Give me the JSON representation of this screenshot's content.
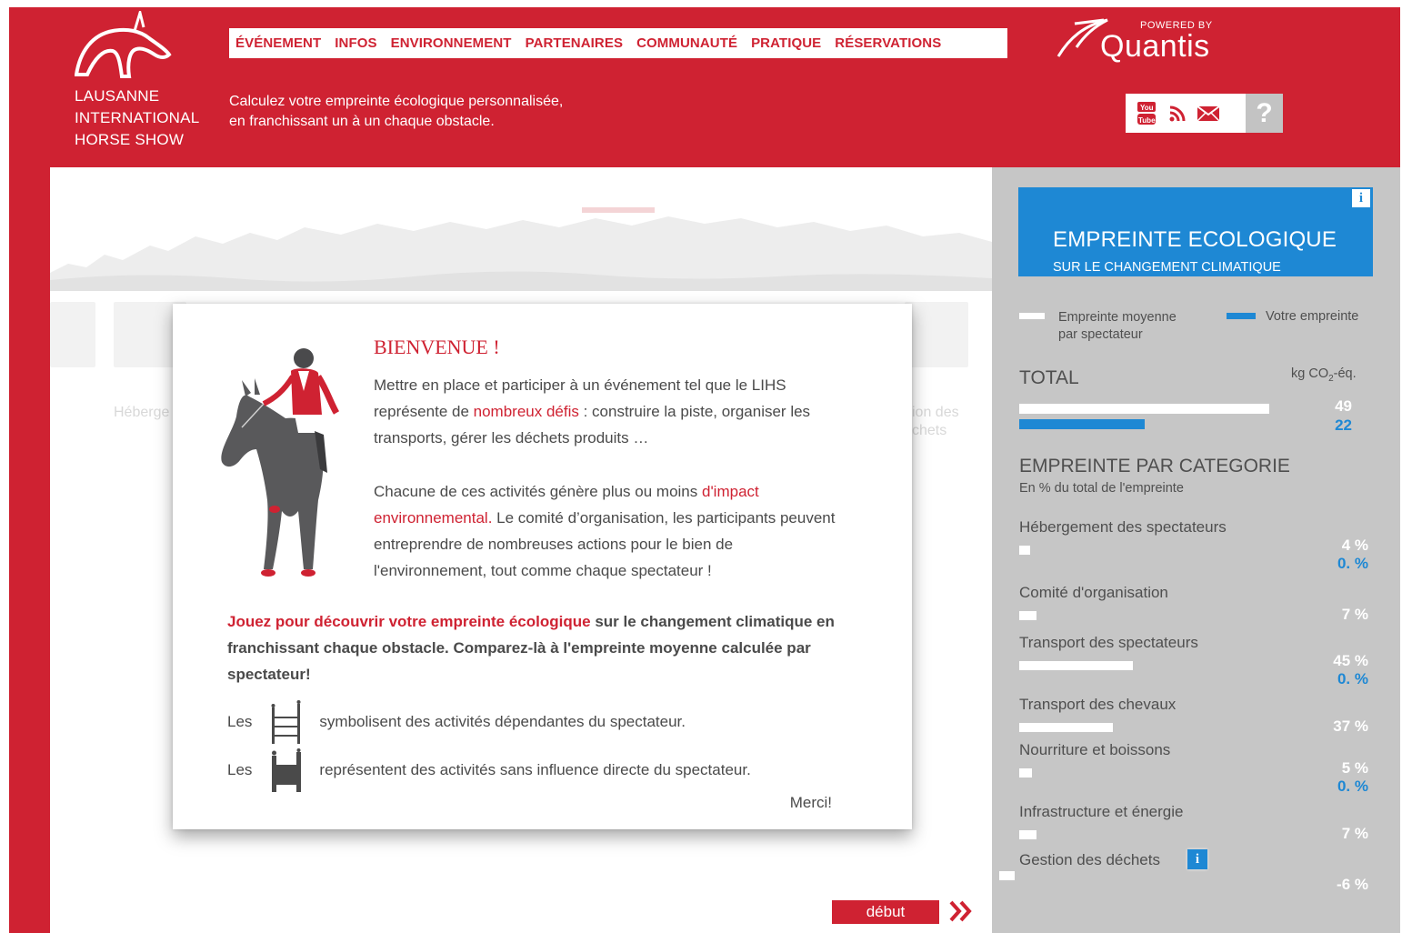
{
  "header": {
    "brand_lines": [
      "LAUSANNE",
      "INTERNATIONAL",
      "HORSE SHOW"
    ],
    "nav": [
      "ÉVÉNEMENT",
      "INFOS",
      "ENVIRONNEMENT",
      "PARTENAIRES",
      "COMMUNAUTÉ",
      "PRATIQUE",
      "RÉSERVATIONS"
    ],
    "tagline": [
      "Calculez votre empreinte écologique personnalisée,",
      "en franchissant un à un chaque obstacle."
    ],
    "powered_by": "POWERED BY",
    "partner": "Quantis",
    "social_icons": [
      "youtube-icon",
      "rss-icon",
      "mail-icon"
    ],
    "help_label": "?",
    "colors": {
      "brand_red": "#cf2232",
      "accent_blue": "#1e88d4",
      "sidebar_grey": "#c6c6c6"
    }
  },
  "main": {
    "bg_labels": [
      "Héberge",
      "ion des",
      "chets"
    ],
    "start_label": "début",
    "start_arrows": "»"
  },
  "modal": {
    "title": "BIENVENUE !",
    "p1_a": "Mettre en place et participer à un événement tel que le LIHS représente de ",
    "p1_b": "nombreux défis",
    "p1_c": " : construire la piste, organiser les transports, gérer les déchets produits …",
    "p2_a": "Chacune de ces activités génère plus ou moins ",
    "p2_b": "d'impact environnemental.",
    "p2_c": " Le comité d’organisation, les participants peuvent entreprendre de nombreuses actions pour le bien de l'environnement, tout comme chaque spectateur !",
    "bold_a": "Jouez pour découvrir votre empreinte écologique",
    "bold_b": " sur le changement climatique en franchissant chaque obstacle. Comparez-là à l'empreinte moyenne calculée par spectateur!",
    "legend1_pre": "Les",
    "legend1_post": "symbolisent des activités dépendantes du spectateur.",
    "legend2_pre": "Les",
    "legend2_post": "représentent des activités sans influence directe du spectateur.",
    "close_label": "Merci!"
  },
  "sidebar": {
    "title": "EMPREINTE ECOLOGIQUE",
    "subtitle": "SUR LE CHANGEMENT CLIMATIQUE",
    "info_label": "i",
    "legend_avg_1": "Empreinte moyenne",
    "legend_avg_2": "par spectateur",
    "legend_yours": "Votre empreinte",
    "total_label": "TOTAL",
    "unit_a": "kg CO",
    "unit_sub": "2",
    "unit_b": "-éq.",
    "total_avg": 49,
    "total_yours": 22,
    "total_avg_text": "49",
    "total_yours_text": "22",
    "cat_title": "EMPREINTE PAR CATEGORIE",
    "cat_subtitle": "En % du total de l'empreinte",
    "categories": [
      {
        "name": "Hébergement des spectateurs",
        "avg": 4,
        "avg_text": "4 %",
        "yours_text": "0. %"
      },
      {
        "name": "Comité d'organisation",
        "avg": 7,
        "avg_text": "7 %",
        "yours_text": ""
      },
      {
        "name": "Transport des spectateurs",
        "avg": 45,
        "avg_text": "45 %",
        "yours_text": "0. %"
      },
      {
        "name": "Transport des chevaux",
        "avg": 37,
        "avg_text": "37 %",
        "yours_text": ""
      },
      {
        "name": "Nourriture et boissons",
        "avg": 5,
        "avg_text": "5 %",
        "yours_text": "0. %"
      },
      {
        "name": "Infrastructure et énergie",
        "avg": 7,
        "avg_text": "7 %",
        "yours_text": ""
      },
      {
        "name": "Gestion des déchets",
        "avg": -6,
        "avg_text": "-6 %",
        "yours_text": ""
      }
    ]
  }
}
